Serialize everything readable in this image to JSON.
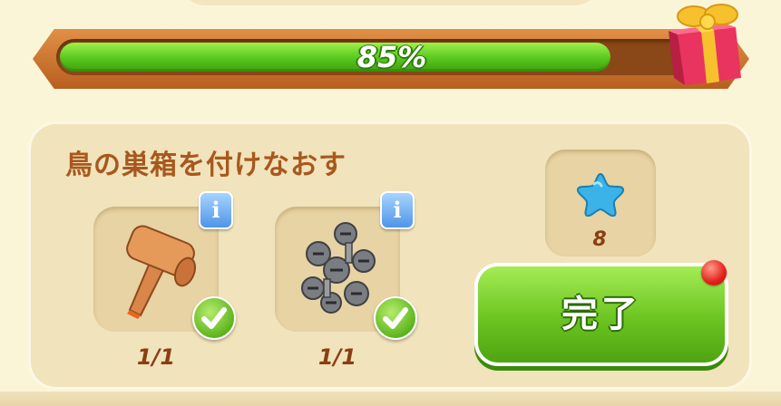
{
  "progress": {
    "label": "85%",
    "fraction": 0.85
  },
  "task": {
    "title": "鳥の巣箱を付けなおす",
    "items": [
      {
        "icon": "mallet-icon",
        "count": "1/1",
        "complete": true
      },
      {
        "icon": "screws-icon",
        "count": "1/1",
        "complete": true
      }
    ]
  },
  "reward": {
    "icon": "blue-star-icon",
    "count": "8"
  },
  "complete_button": {
    "label": "完了"
  },
  "colors": {
    "progress_green": "#58c71d",
    "title_brown": "#a8581d",
    "button_green": "#6bc420",
    "notification_red": "#e3201a"
  }
}
